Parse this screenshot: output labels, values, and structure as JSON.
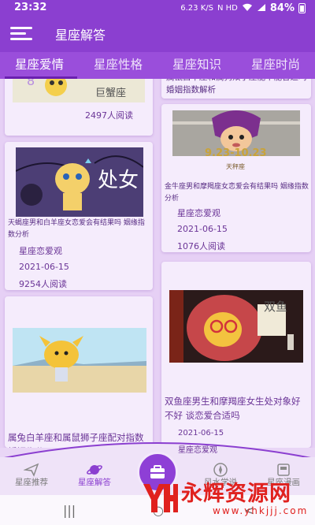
{
  "status_bar": {
    "time": "23:32",
    "network": "6.23 K/S",
    "icons": "N  HD",
    "battery": "84%"
  },
  "app_bar": {
    "title": "星座解答"
  },
  "tabs": [
    {
      "label": "星座爱情",
      "active": true
    },
    {
      "label": "星座性格",
      "active": false
    },
    {
      "label": "星座知识",
      "active": false
    },
    {
      "label": "星座时尚",
      "active": false
    }
  ],
  "cards": {
    "card1": {
      "image_caption": "巨蟹座",
      "reads": "2497人阅读"
    },
    "card2": {
      "title_partial": "属鼠白羊座和属狗双子座能不能合适吗 婚姻指数解析"
    },
    "card3": {
      "image_caption": "9.23-10.23",
      "image_label": "天秤座",
      "title": "金牛座男和摩羯座女恋爱会有结果吗 姻缘指数分析",
      "category": "星座恋爱观",
      "date": "2021-06-15",
      "reads": "1076人阅读"
    },
    "card4": {
      "image_caption": "处女",
      "title": "天蝎座男和白羊座女恋爱会有结果吗 姻缘指数分析",
      "category": "星座恋爱观",
      "date": "2021-06-15",
      "reads": "9254人阅读"
    },
    "card5": {
      "image_caption": "双鱼",
      "title": "双鱼座男生和摩羯座女生处对象好不好 谈恋爱合适吗",
      "date": "2021-06-15",
      "category": "星座恋爱观"
    },
    "card6": {
      "title": "属兔白羊座和属鼠狮子座配对指数 婚姻缘分"
    }
  },
  "bottom_nav": [
    {
      "label": "星座推荐",
      "active": false
    },
    {
      "label": "星座解答",
      "active": true
    },
    {
      "label": "",
      "active": false
    },
    {
      "label": "风水学说",
      "active": false
    },
    {
      "label": "星座漫画",
      "active": false
    }
  ],
  "watermark": {
    "text": "永辉资源网",
    "url": "www.yhkjjj.com"
  },
  "colors": {
    "primary": "#8b3fd0",
    "tab_bg": "#9a4edb",
    "content_bg": "#e6d0f5",
    "card_bg": "#f5ecfc",
    "watermark": "#e0211e"
  }
}
